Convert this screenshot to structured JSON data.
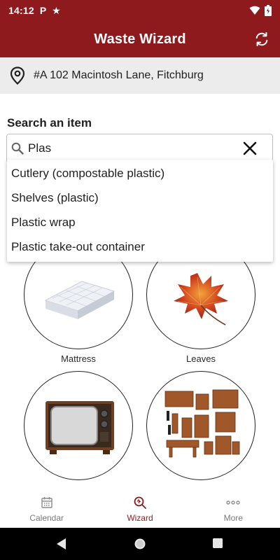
{
  "status_bar": {
    "time": "14:12",
    "left_icons": [
      "p-icon",
      "star-icon"
    ],
    "right_icons": [
      "wifi-icon",
      "battery-icon"
    ]
  },
  "app_bar": {
    "title": "Waste Wizard",
    "action_icon": "refresh-icon"
  },
  "address": {
    "icon": "location-pin-icon",
    "text": "#A 102 Macintosh Lane, Fitchburg"
  },
  "search": {
    "heading": "Search an item",
    "value": "Plas",
    "placeholder": "",
    "suggestions": [
      "Cutlery (compostable plastic)",
      "Shelves (plastic)",
      "Plastic wrap",
      "Plastic take-out container"
    ]
  },
  "tiles": [
    {
      "label": "Mattress",
      "icon": "mattress-image"
    },
    {
      "label": "Leaves",
      "icon": "leaves-image"
    },
    {
      "label": "",
      "icon": "television-image"
    },
    {
      "label": "",
      "icon": "furniture-image"
    }
  ],
  "bottom_nav": {
    "items": [
      {
        "label": "Calendar",
        "icon": "calendar-icon",
        "active": false
      },
      {
        "label": "Wizard",
        "icon": "wizard-search-icon",
        "active": true
      },
      {
        "label": "More",
        "icon": "more-dots-icon",
        "active": false
      }
    ]
  },
  "colors": {
    "primary": "#8e1a1e",
    "address_bg": "#ececec",
    "inactive_nav": "#7a7a7a"
  }
}
